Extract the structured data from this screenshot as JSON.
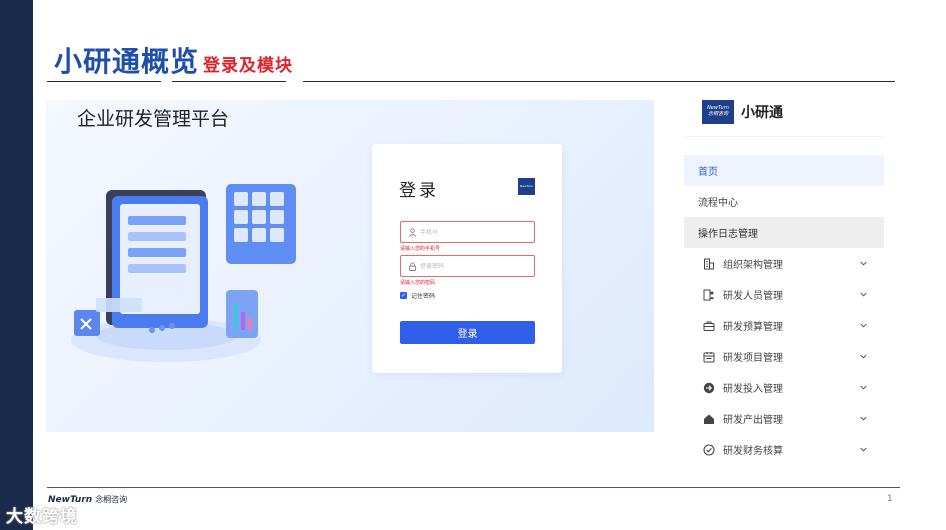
{
  "slide": {
    "title_main": "小研通概览",
    "title_sub": "登录及模块",
    "page_number": "1",
    "footer_brand_en": "NewTurn",
    "footer_brand_cn": "念桐咨询",
    "watermark": "大数跨境"
  },
  "login_panel": {
    "heading": "企业研发管理平台",
    "card": {
      "title": "登录",
      "logo_text": "NewTurn",
      "phone_placeholder": "手机号",
      "phone_error": "请输入您的手机号",
      "password_placeholder": "登录密码",
      "password_error": "请输入您的密码",
      "remember_label": "记住密码",
      "remember_checked": true,
      "login_button": "登录"
    }
  },
  "sidebar": {
    "brand_logo_line1": "NewTurn",
    "brand_logo_line2": "念桐咨询",
    "brand_name": "小研通",
    "items": [
      {
        "label": "首页",
        "state": "active"
      },
      {
        "label": "流程中心",
        "state": "normal"
      },
      {
        "label": "操作日志管理",
        "state": "hover"
      },
      {
        "label": "组织架构管理",
        "icon": "building-icon",
        "expandable": true
      },
      {
        "label": "研发人员管理",
        "icon": "person-badge-icon",
        "expandable": true
      },
      {
        "label": "研发预算管理",
        "icon": "briefcase-icon",
        "expandable": true
      },
      {
        "label": "研发项目管理",
        "icon": "calendar-icon",
        "expandable": true
      },
      {
        "label": "研发投入管理",
        "icon": "arrow-circle-icon",
        "expandable": true
      },
      {
        "label": "研发产出管理",
        "icon": "house-icon",
        "expandable": true
      },
      {
        "label": "研发财务核算",
        "icon": "check-circle-icon",
        "expandable": true
      }
    ]
  },
  "colors": {
    "title_blue": "#1f4fa8",
    "title_red": "#e0202a",
    "accent_blue": "#2f62e6",
    "dark_navy": "#1a2a4a",
    "error_red": "#e0202a"
  }
}
